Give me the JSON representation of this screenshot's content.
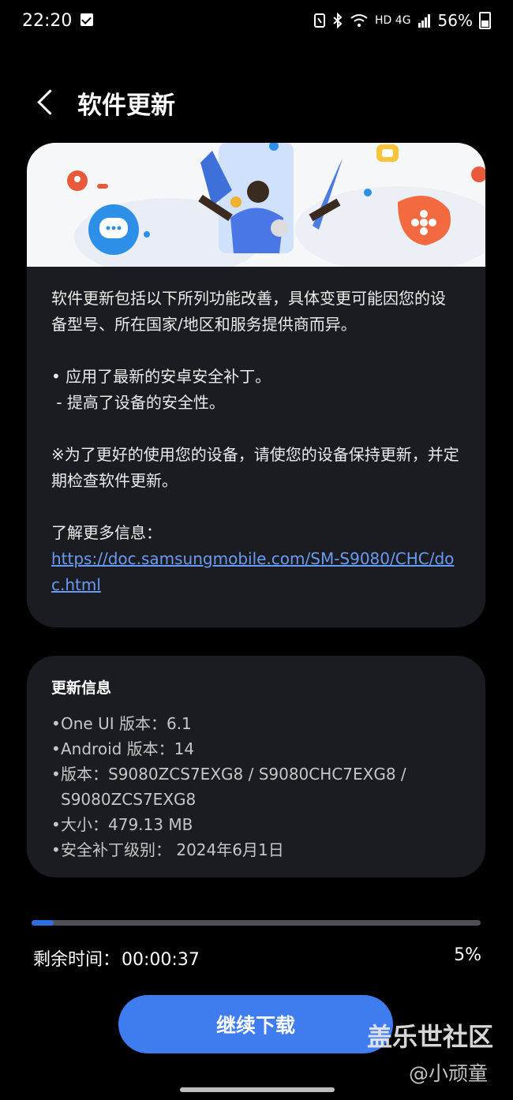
{
  "status_bar": {
    "time": "22:20",
    "battery_percent": "56%",
    "signal_text": "HD 4G",
    "icons": [
      "checkbox-icon",
      "nfc-icon",
      "bluetooth-icon",
      "wifi-icon",
      "signal-icon",
      "battery-icon"
    ]
  },
  "header": {
    "title": "软件更新"
  },
  "release_notes": {
    "intro": "软件更新包括以下所列功能改善，具体变更可能因您的设备型号、所在国家/地区和服务提供商而异。",
    "bullet1": "• 应用了最新的安卓安全补丁。",
    "bullet1_sub": " - 提高了设备的安全性。",
    "note": "※为了更好的使用您的设备，请使您的设备保持更新，并定期检查软件更新。",
    "more_info_label": "了解更多信息：",
    "link": "https://doc.samsungmobile.com/SM-S9080/CHC/doc.html"
  },
  "update_info": {
    "heading": "更新信息",
    "items": [
      "One UI 版本：6.1",
      "Android 版本：14",
      "版本：S9080ZCS7EXG8 / S9080CHC7EXG8 / S9080ZCS7EXG8",
      "大小：479.13 MB",
      "安全补丁级别： 2024年6月1日"
    ]
  },
  "download": {
    "progress": 0.05,
    "remaining_label": "剩余时间：",
    "remaining_time": "00:00:37",
    "percent_text": "5%",
    "button_label": "继续下载"
  },
  "watermark": {
    "line1": "盖乐世社区",
    "line2": "@小顽童"
  },
  "colors": {
    "accent": "#3e7cf0",
    "link": "#6a9bf4",
    "card": "#1b1c21"
  }
}
